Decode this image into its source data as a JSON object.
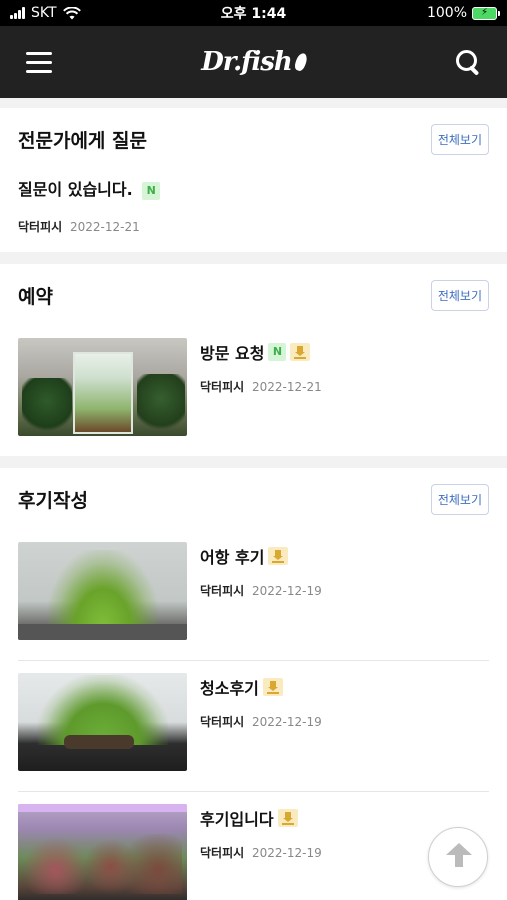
{
  "status_bar": {
    "carrier": "SKT",
    "time": "오후 1:44",
    "battery": "100%"
  },
  "header": {
    "logo_text": "Dr.fish",
    "menu_icon": "hamburger-icon",
    "search_icon": "search-icon"
  },
  "sections": {
    "expert": {
      "title": "전문가에게 질문",
      "view_all": "전체보기",
      "question": {
        "title": "질문이 있습니다.",
        "badge": "N",
        "author": "닥터피시",
        "date": "2022-12-21"
      }
    },
    "reservation": {
      "title": "예약",
      "view_all": "전체보기",
      "posts": [
        {
          "title": "방문 요청",
          "badge": "N",
          "author": "닥터피시",
          "date": "2022-12-21"
        }
      ]
    },
    "review": {
      "title": "후기작성",
      "view_all": "전체보기",
      "posts": [
        {
          "title": "어항 후기",
          "author": "닥터피시",
          "date": "2022-12-19"
        },
        {
          "title": "청소후기",
          "author": "닥터피시",
          "date": "2022-12-19"
        },
        {
          "title": "후기입니다",
          "author": "닥터피시",
          "date": "2022-12-19"
        }
      ]
    }
  },
  "scroll_top_icon": "arrow-up-icon"
}
